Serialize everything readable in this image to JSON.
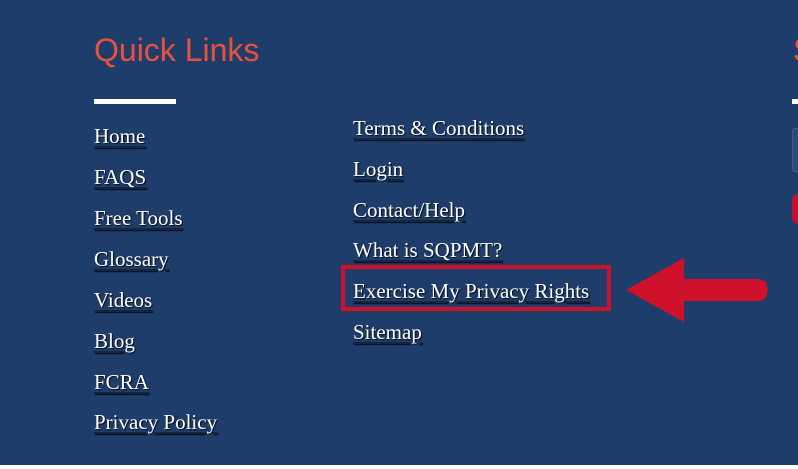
{
  "quick_links": {
    "title": "Quick Links",
    "column_1": [
      {
        "label": "Home"
      },
      {
        "label": "FAQS"
      },
      {
        "label": "Free Tools"
      },
      {
        "label": "Glossary"
      },
      {
        "label": "Videos"
      },
      {
        "label": "Blog"
      },
      {
        "label": "FCRA"
      },
      {
        "label": "Privacy Policy"
      }
    ],
    "column_2": [
      {
        "label": "Terms & Conditions"
      },
      {
        "label": "Login"
      },
      {
        "label": "Contact/Help"
      },
      {
        "label": "What is SQPMT?"
      },
      {
        "label": "Exercise My Privacy Rights"
      },
      {
        "label": "Sitemap"
      }
    ]
  },
  "next_section": {
    "title_fragment": "S"
  },
  "colors": {
    "footer_background": "#1f3d6b",
    "title_accent": "#e8523c",
    "annotation_red": "#d0112b",
    "link_text": "#ffffff"
  },
  "icons": {
    "annotation": "left-pointing-arrow-icon"
  }
}
